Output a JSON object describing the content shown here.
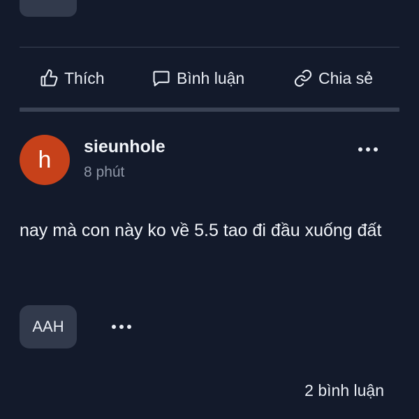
{
  "previous_post": {
    "reaction_chip": ""
  },
  "actions": {
    "like_label": "Thích",
    "comment_label": "Bình luận",
    "share_label": "Chia sẻ"
  },
  "post": {
    "avatar_letter": "h",
    "avatar_color": "#c7411a",
    "username": "sieunhole",
    "time": "8 phút",
    "text": "nay mà con này ko về 5.5 tao đi đầu xuống đất",
    "reaction_label": "AAH",
    "comment_count": "2 bình luận"
  },
  "colors": {
    "background": "#131a2b",
    "chip": "#323a4c",
    "divider": "#3a4254",
    "muted_text": "#8f97a7"
  },
  "icons": {
    "like": "thumbs-up-icon",
    "comment": "speech-bubble-icon",
    "share": "link-icon",
    "more": "more-horizontal-icon"
  }
}
